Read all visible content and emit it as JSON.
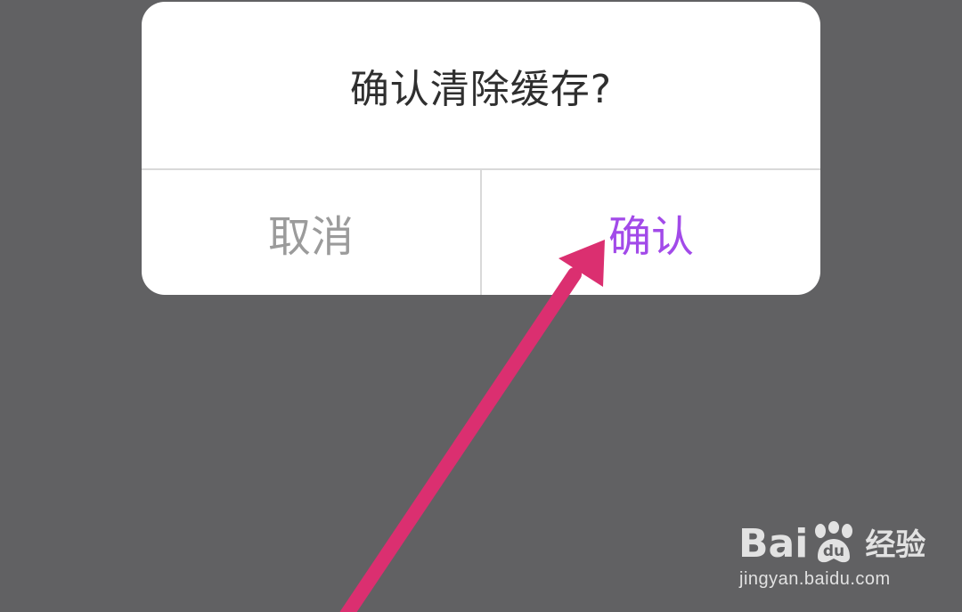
{
  "dialog": {
    "title": "确认清除缓存?",
    "cancel_label": "取消",
    "confirm_label": "确认"
  },
  "watermark": {
    "brand_text": "Bai",
    "brand_text_2": "du",
    "product_text": "经验",
    "url": "jingyan.baidu.com"
  },
  "icons": {
    "annotation_arrow": "arrow-icon",
    "watermark_paw": "paw-icon"
  },
  "colors": {
    "overlay_background": "#616163",
    "dialog_background": "#ffffff",
    "title_text": "#2f2f2f",
    "cancel_text": "#9b9b9b",
    "confirm_text": "#a24ae9",
    "arrow_color": "#db2f70",
    "divider": "#d9d9d9"
  }
}
